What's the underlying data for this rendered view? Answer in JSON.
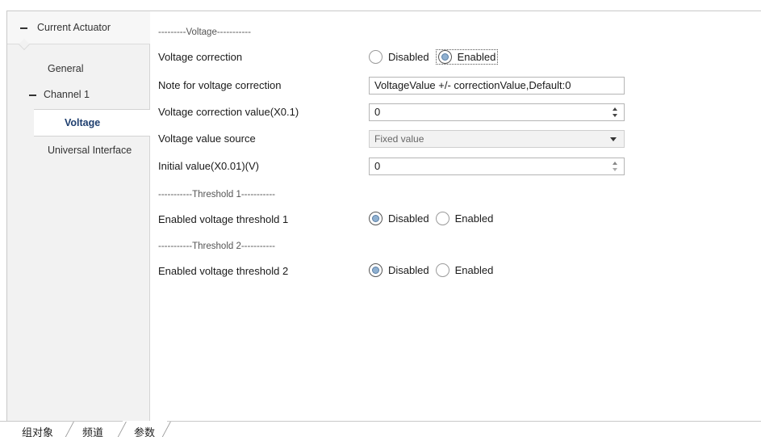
{
  "sidebar": {
    "root": "Current Actuator",
    "general": "General",
    "channel": "Channel 1",
    "selected": "Voltage",
    "universal": "Universal Interface"
  },
  "content": {
    "sep_voltage": "---------Voltage-----------",
    "voltage_correction": {
      "label": "Voltage correction",
      "options": [
        "Disabled",
        "Enabled"
      ],
      "selected": "Enabled"
    },
    "note": {
      "label": "Note for voltage correction",
      "value": "VoltageValue +/- correctionValue,Default:0"
    },
    "correction_value": {
      "label": "Voltage correction value(X0.1)",
      "value": "0"
    },
    "value_source": {
      "label": "Voltage value source",
      "value": "Fixed value"
    },
    "initial_value": {
      "label": "Initial value(X0.01)(V)",
      "value": "0"
    },
    "sep_threshold1": "-----------Threshold 1-----------",
    "threshold1": {
      "label": "Enabled voltage threshold 1",
      "options": [
        "Disabled",
        "Enabled"
      ],
      "selected": "Disabled"
    },
    "sep_threshold2": "-----------Threshold 2-----------",
    "threshold2": {
      "label": "Enabled voltage threshold 2",
      "options": [
        "Disabled",
        "Enabled"
      ],
      "selected": "Disabled"
    }
  },
  "tabs": [
    "组对象",
    "频道",
    "参数"
  ],
  "active_tab": "参数",
  "colors": {
    "sidebar_bg": "#f2f2f2",
    "selected_text": "#1f3f6f",
    "radio_fill": "#8fb0d0"
  }
}
